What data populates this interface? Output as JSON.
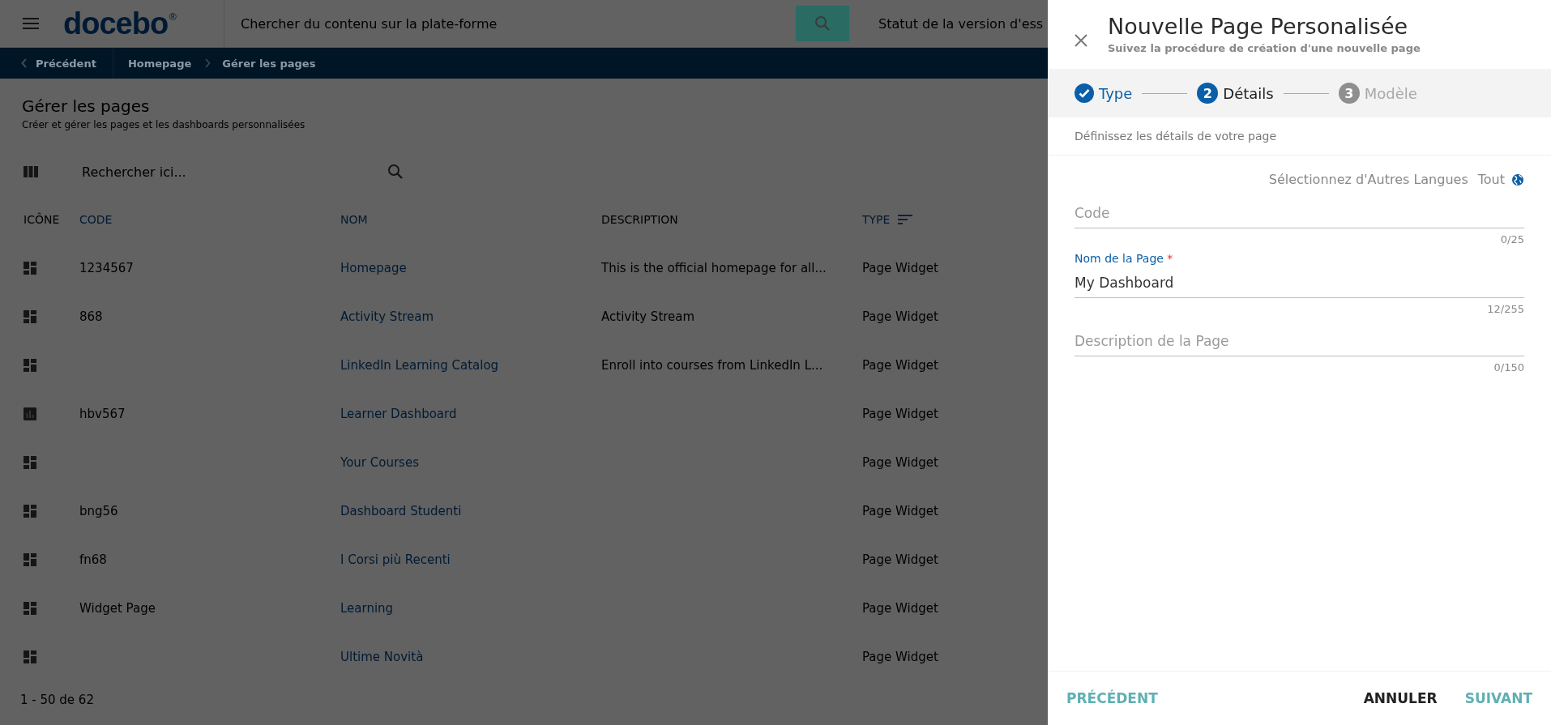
{
  "header": {
    "logo": "docebo",
    "logo_mark": "®",
    "search_placeholder": "Chercher du contenu sur la plate-forme",
    "trial_status": "Statut de la version d'ess"
  },
  "breadcrumb": {
    "back": "Précédent",
    "items": [
      "Homepage",
      "Gérer les pages"
    ]
  },
  "page": {
    "title": "Gérer les pages",
    "subtitle": "Créer et gérer les pages et les dashboards personnalisées",
    "search_placeholder": "Rechercher ici..."
  },
  "table": {
    "columns": [
      {
        "label": "ICÔNE",
        "sortable": false,
        "sorted": false
      },
      {
        "label": "CODE",
        "sortable": true,
        "sorted": false
      },
      {
        "label": "NOM",
        "sortable": true,
        "sorted": false
      },
      {
        "label": "DESCRIPTION",
        "sortable": false,
        "sorted": false
      },
      {
        "label": "TYPE",
        "sortable": true,
        "sorted": true
      }
    ],
    "rows": [
      {
        "kind": "widget",
        "code": "1234567",
        "name": "Homepage",
        "description": "This is the official homepage for all...",
        "type": "Page Widget"
      },
      {
        "kind": "widget",
        "code": "868",
        "name": "Activity Stream",
        "description": "Activity Stream",
        "type": "Page Widget"
      },
      {
        "kind": "widget",
        "name": "LinkedIn Learning Catalog",
        "description": "Enroll into courses from LinkedIn L...",
        "type": "Page Widget"
      },
      {
        "kind": "chart",
        "code": "hbv567",
        "name": "Learner Dashboard",
        "type": "Page Widget"
      },
      {
        "kind": "widget",
        "name": "Your Courses",
        "type": "Page Widget"
      },
      {
        "kind": "widget",
        "code": "bng56",
        "name": "Dashboard Studenti",
        "type": "Page Widget"
      },
      {
        "kind": "widget",
        "code": "fn68",
        "name": "I Corsi più Recenti",
        "type": "Page Widget"
      },
      {
        "kind": "widget",
        "code": "Widget Page",
        "name": "Learning",
        "type": "Page Widget"
      },
      {
        "kind": "widget",
        "name": "Ultime Novità",
        "type": "Page Widget"
      }
    ],
    "pagination": "1 - 50 de 62"
  },
  "panel": {
    "title": "Nouvelle Page Personalisée",
    "subtitle": "Suivez la procédure de création d'une nouvelle page",
    "steps": [
      {
        "label": "Type",
        "completed": true,
        "selected": false
      },
      {
        "number": "2",
        "label": "Détails",
        "completed": false,
        "selected": true
      },
      {
        "number": "3",
        "label": "Modèle",
        "completed": false,
        "selected": false
      }
    ],
    "intro": "Définissez les détails de votre page",
    "languages": {
      "label": "Sélectionnez d'Autres Langues",
      "value": "Tout"
    },
    "fields": [
      {
        "placeholder": "Code",
        "counter": "0/25"
      },
      {
        "label": "Nom de la Page",
        "required_mark": "*",
        "value": "My Dashboard",
        "counter": "12/255"
      },
      {
        "placeholder": "Description de la Page",
        "counter": "0/150"
      }
    ],
    "buttons": [
      {
        "kind": "back",
        "label": "PRÉCÉDENT"
      },
      {
        "kind": "cancel",
        "label": "ANNULER"
      },
      {
        "kind": "next",
        "label": "SUIVANT"
      }
    ]
  }
}
